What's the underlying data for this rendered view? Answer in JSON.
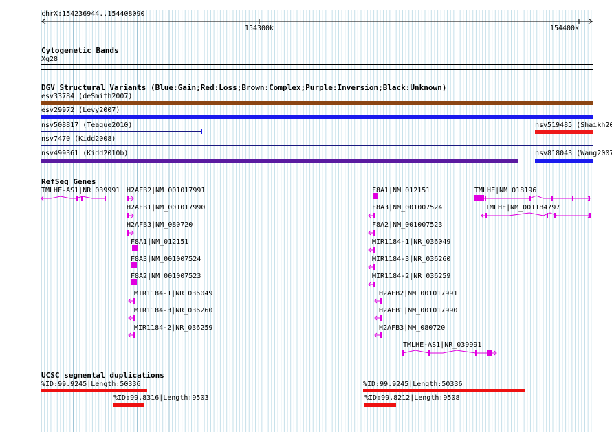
{
  "ruler": {
    "location": "chrX:154236944..154408090",
    "ticks": [
      {
        "label": "154300k"
      },
      {
        "label": "154400k"
      }
    ]
  },
  "tracks": {
    "cytoband": {
      "title": "Cytogenetic Bands",
      "band": "Xq28"
    },
    "dgv": {
      "title": "DGV Structural Variants (Blue:Gain;Red:Loss;Brown:Complex;Purple:Inversion;Black:Unknown)",
      "colors": {
        "gain": "#1a1aee",
        "loss": "#ee1a1a",
        "complex": "#8b4513",
        "inversion": "#5a1aa0",
        "unknown": "#1a1a80"
      },
      "variants": [
        {
          "label": "esv33784 (deSmith2007)",
          "type": "complex"
        },
        {
          "label": "esv29972 (Levy2007)",
          "type": "gain"
        },
        {
          "label": "nsv508817 (Teague2010)",
          "type": "unknown"
        },
        {
          "label": "nsv519485 (Shaikh20",
          "type": "loss"
        },
        {
          "label": "nsv7470 (Kidd2008)",
          "type": "unknown"
        },
        {
          "label": "nsv499361 (Kidd2010b)",
          "type": "inversion"
        },
        {
          "label": "nsv818043 (Wang2007",
          "type": "gain"
        }
      ]
    },
    "refseq": {
      "title": "RefSeq Genes",
      "color": "#e000e0",
      "genes": [
        "TMLHE-AS1|NR_039991",
        "H2AFB2|NM_001017991",
        "H2AFB1|NM_001017990",
        "H2AFB3|NM_080720",
        "F8A1|NM_012151",
        "F8A3|NM_001007524",
        "F8A2|NM_001007523",
        "MIR1184-1|NR_036049",
        "MIR1184-3|NR_036260",
        "MIR1184-2|NR_036259",
        "F8A1|NM_012151",
        "F8A3|NM_001007524",
        "F8A2|NM_001007523",
        "MIR1184-1|NR_036049",
        "MIR1184-3|NR_036260",
        "MIR1184-2|NR_036259",
        "H2AFB2|NM_001017991",
        "H2AFB1|NM_001017990",
        "H2AFB3|NM_080720",
        "TMLHE-AS1|NR_039991",
        "TMLHE|NM_018196",
        "TMLHE|NM_001184797"
      ]
    },
    "segdups": {
      "title": "UCSC segmental duplications",
      "color": "#ee1111",
      "items": [
        "%ID:99.9245|Length:50336",
        "%ID:99.8316|Length:9503",
        "%ID:99.9245|Length:50336",
        "%ID:99.8212|Length:9508"
      ]
    }
  }
}
